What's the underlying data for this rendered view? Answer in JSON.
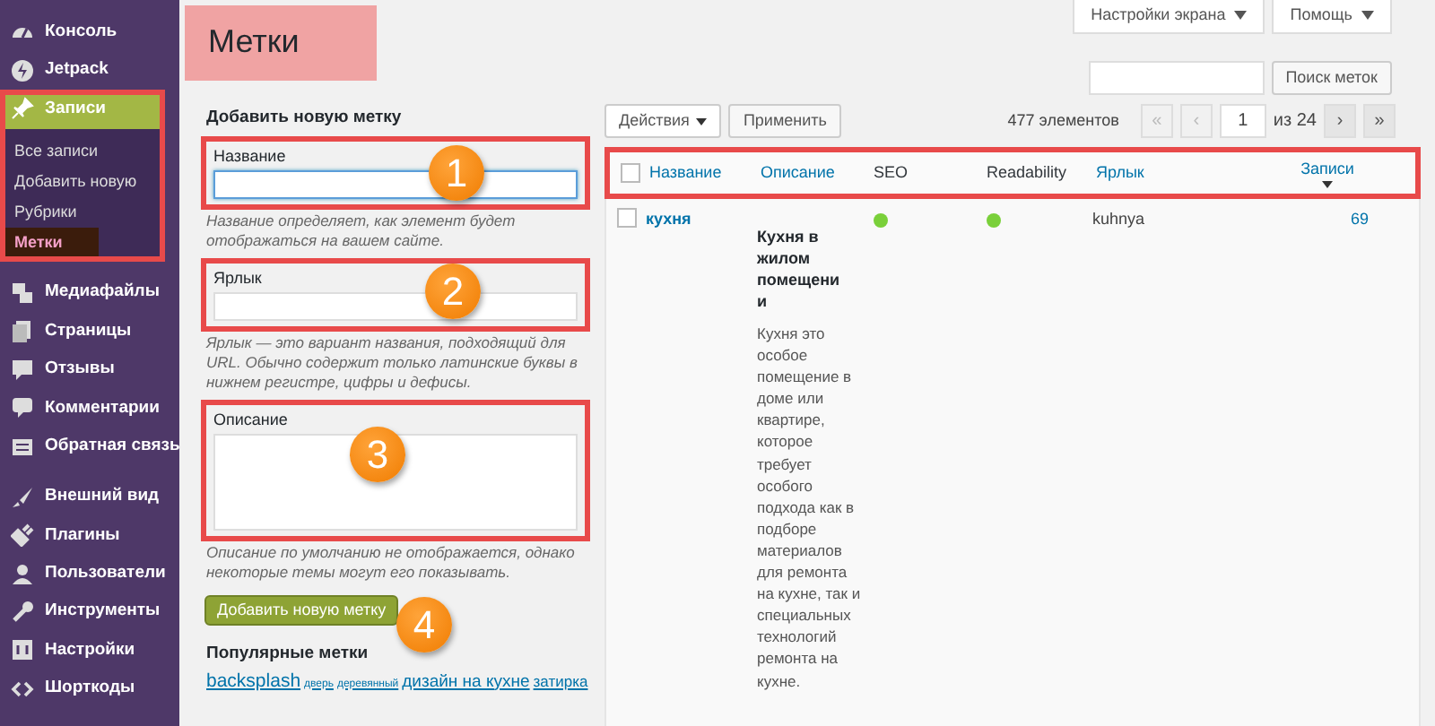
{
  "sidebar": {
    "items": [
      {
        "label": "Консоль",
        "selected": false
      },
      {
        "label": "Jetpack",
        "selected": false
      },
      {
        "label": "Записи",
        "selected": true,
        "highlighted": true,
        "children": [
          {
            "label": "Все записи",
            "selected": false
          },
          {
            "label": "Добавить новую",
            "selected": false
          },
          {
            "label": "Рубрики",
            "selected": false
          },
          {
            "label": "Метки",
            "selected": true
          }
        ]
      },
      {
        "label": "Медиафайлы",
        "selected": false
      },
      {
        "label": "Страницы",
        "selected": false
      },
      {
        "label": "Отзывы",
        "selected": false
      },
      {
        "label": "Комментарии",
        "selected": false
      },
      {
        "label": "Обратная связь",
        "selected": false
      },
      {
        "label": "Внешний вид",
        "selected": false
      },
      {
        "label": "Плагины",
        "selected": false
      },
      {
        "label": "Пользователи",
        "selected": false
      },
      {
        "label": "Инструменты",
        "selected": false
      },
      {
        "label": "Настройки",
        "selected": false
      },
      {
        "label": "Шорткоды",
        "selected": false
      }
    ]
  },
  "page_title": "Метки",
  "top_buttons": [
    "Настройки экрана",
    "Помощь"
  ],
  "search": {
    "button": "Поиск меток"
  },
  "form": {
    "title": "Добавить новую метку",
    "fields": [
      {
        "kind": "input",
        "label": "Название",
        "focused": true,
        "highlighted": true,
        "callout": "1",
        "help": "Название определяет, как элемент будет отображаться на вашем сайте."
      },
      {
        "kind": "input",
        "label": "Ярлык",
        "focused": false,
        "highlighted": true,
        "callout": "2",
        "help": "Ярлык — это вариант названия, подходящий для URL. Обычно содержит только латинские буквы в нижнем регистре, цифры и дефисы."
      },
      {
        "kind": "textarea",
        "label": "Описание",
        "focused": false,
        "highlighted": true,
        "callout": "3",
        "help": "Описание по умолчанию не отображается, однако некоторые темы могут его показывать."
      }
    ],
    "submit": {
      "label": "Добавить новую метку",
      "callout": "4"
    }
  },
  "popular": {
    "title": "Популярные метки",
    "tags": [
      {
        "label": "backsplash",
        "kind": "large"
      },
      {
        "label": "дверь",
        "kind": "small"
      },
      {
        "label": "деревянный",
        "kind": "small"
      },
      {
        "label": "дизайн на кухне",
        "kind": "medium"
      },
      {
        "label": "затирка",
        "kind": "normal"
      }
    ]
  },
  "toolbar": {
    "bulk_action": "Действия",
    "apply": "Применить",
    "count": "477 элементов",
    "pager": {
      "first": {
        "label": "«",
        "disabled": true
      },
      "prev": {
        "label": "‹",
        "disabled": true
      },
      "page": "1",
      "of": "из 24",
      "next": {
        "label": "›",
        "disabled": false
      },
      "last": {
        "label": "»",
        "disabled": false
      }
    }
  },
  "table": {
    "highlighted": true,
    "columns": [
      {
        "label": "Название",
        "sortable": true,
        "sorted": false
      },
      {
        "label": "Описание",
        "sortable": true,
        "sorted": false
      },
      {
        "label": "SEO",
        "sortable": false,
        "sorted": false
      },
      {
        "label": "Readability",
        "sortable": false,
        "sorted": false
      },
      {
        "label": "Ярлык",
        "sortable": true,
        "sorted": false
      },
      {
        "label": "Записи",
        "sortable": true,
        "sorted": true
      }
    ],
    "rows": [
      {
        "checked": false,
        "name": "кухня",
        "description_title": "Кухня в жилом помещении",
        "description": "Кухня это особое помещение в доме или квартире, которое требует особого подхода как в подборе материалов для ремонта на кухне, так и специальных технологий ремонта на кухне.",
        "seo": {
          "color": "#7ad03a"
        },
        "readability": {
          "color": "#7ad03a"
        },
        "slug": "kuhnya",
        "count": "69"
      }
    ]
  }
}
